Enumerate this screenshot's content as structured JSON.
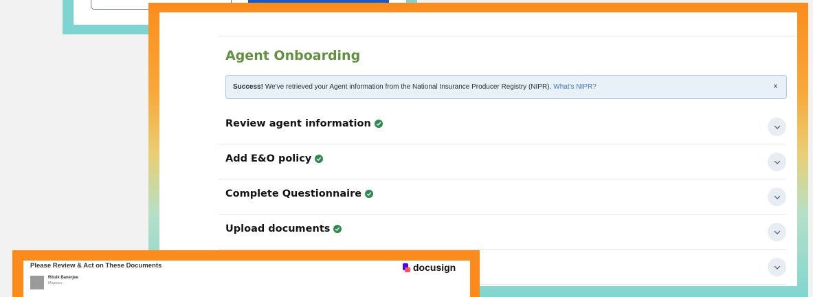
{
  "onboarding": {
    "title": "Agent Onboarding",
    "alert": {
      "strong": "Success!",
      "message": "We've retrieved your Agent information from the National Insurance Producer Registry (NIPR).",
      "link": "What's NIPR?",
      "close": "x"
    },
    "sections": [
      {
        "label": "Review agent information",
        "complete": true
      },
      {
        "label": "Add E&O policy",
        "complete": true
      },
      {
        "label": "Complete Questionnaire",
        "complete": true
      },
      {
        "label": "Upload documents",
        "complete": true
      },
      {
        "label": "",
        "complete": false
      }
    ]
  },
  "docusign": {
    "title": "Please Review & Act on These Documents",
    "brand": "docusign",
    "sender_name": "Rituik Banerjee",
    "sender_company": "Majesco"
  },
  "colors": {
    "title_green": "#5f9140",
    "check_green": "#2e8b4e",
    "primary_blue": "#1959c9",
    "frame_orange": "#fb8c1c",
    "frame_teal": "#7dd4d1"
  }
}
